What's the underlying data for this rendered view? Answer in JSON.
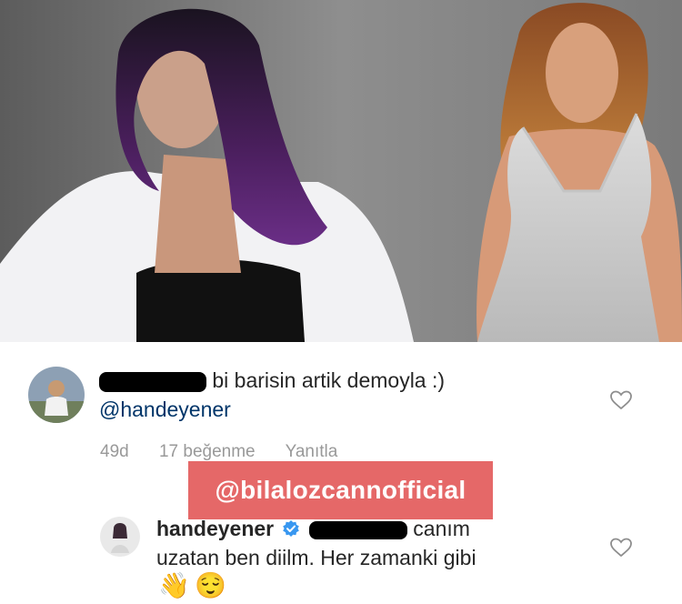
{
  "comment1": {
    "text": "bi barisin artik demoyla :)",
    "mention": "@handeyener",
    "time": "49d",
    "likes": "17 beğenme",
    "reply": "Yanıtla"
  },
  "watermark": "@bilalozcannofficial",
  "comment2": {
    "username": "handeyener",
    "line1": "canım",
    "line2": "uzatan ben diilm. Her zamanki gibi",
    "emoji1": "👋",
    "emoji2": "😌"
  },
  "icons": {
    "heart": "heart-outline-icon",
    "verified": "verified-badge-icon"
  },
  "colors": {
    "mention": "#003569",
    "meta": "#999999",
    "watermark_bg": "#e56868",
    "verified": "#3897f0"
  }
}
